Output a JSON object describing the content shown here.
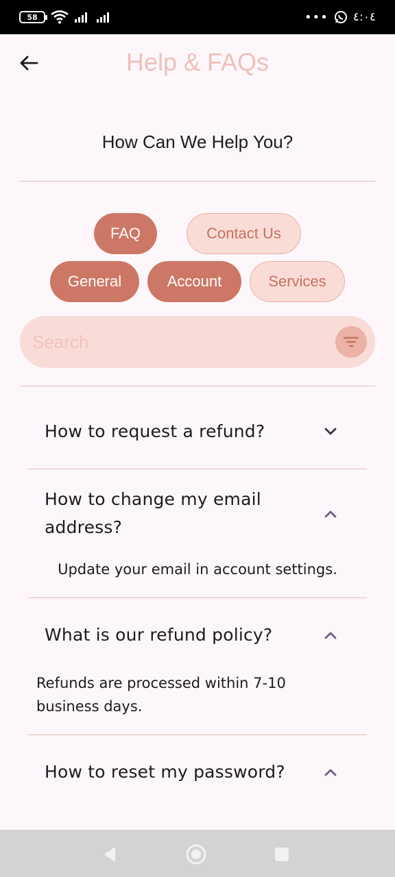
{
  "status_bar": {
    "battery": "58",
    "time": "٤:٠٤",
    "dots": "•••"
  },
  "app_bar": {
    "title": "Help & FAQs"
  },
  "heading": "How Can We Help You?",
  "tabs": [
    {
      "label": "FAQ",
      "active": true
    },
    {
      "label": "Contact Us",
      "active": false
    }
  ],
  "categories": [
    {
      "label": "General",
      "active": true
    },
    {
      "label": "Account",
      "active": true
    },
    {
      "label": "Services",
      "active": false
    }
  ],
  "search": {
    "placeholder": "Search",
    "value": ""
  },
  "faqs": [
    {
      "question": "How to request a refund?",
      "expanded": false,
      "answer": ""
    },
    {
      "question": "How to change my email address?",
      "expanded": true,
      "answer": "Update your email in account settings."
    },
    {
      "question": "What is our refund policy?",
      "expanded": true,
      "answer": "Refunds are processed within 7-10 business days."
    },
    {
      "question": "How to reset my password?",
      "expanded": true,
      "answer": ""
    }
  ],
  "colors": {
    "accent": "#cd7766",
    "accent_light": "#fadcd7",
    "title": "#efc0b6",
    "background": "#fdf7fb",
    "chevron": "#6f5b8a"
  }
}
